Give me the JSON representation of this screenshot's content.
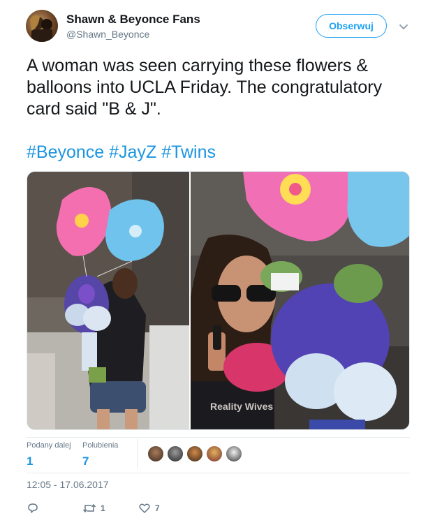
{
  "author": {
    "display_name": "Shawn & Beyonce Fans",
    "handle": "@Shawn_Beyonce"
  },
  "follow_button": {
    "label": "Obserwuj"
  },
  "tweet": {
    "text": "A woman was seen carrying these flowers & balloons into UCLA Friday. The congratulatory card said \"B & J\".",
    "hashtags": [
      "#Beyonce",
      "#JayZ",
      "#Twins"
    ]
  },
  "media": {
    "watermark": "Reality Wives"
  },
  "stats": {
    "retweets_label": "Podany dalej",
    "retweets_value": "1",
    "likes_label": "Polubienia",
    "likes_value": "7"
  },
  "timestamp": "12:05 - 17.06.2017",
  "actions": {
    "reply_icon": "reply-icon",
    "retweet_icon": "retweet-icon",
    "retweet_count": "1",
    "like_icon": "heart-icon",
    "like_count": "7"
  },
  "colors": {
    "accent": "#1da1f2",
    "link": "#1b95e0",
    "muted": "#657786"
  }
}
